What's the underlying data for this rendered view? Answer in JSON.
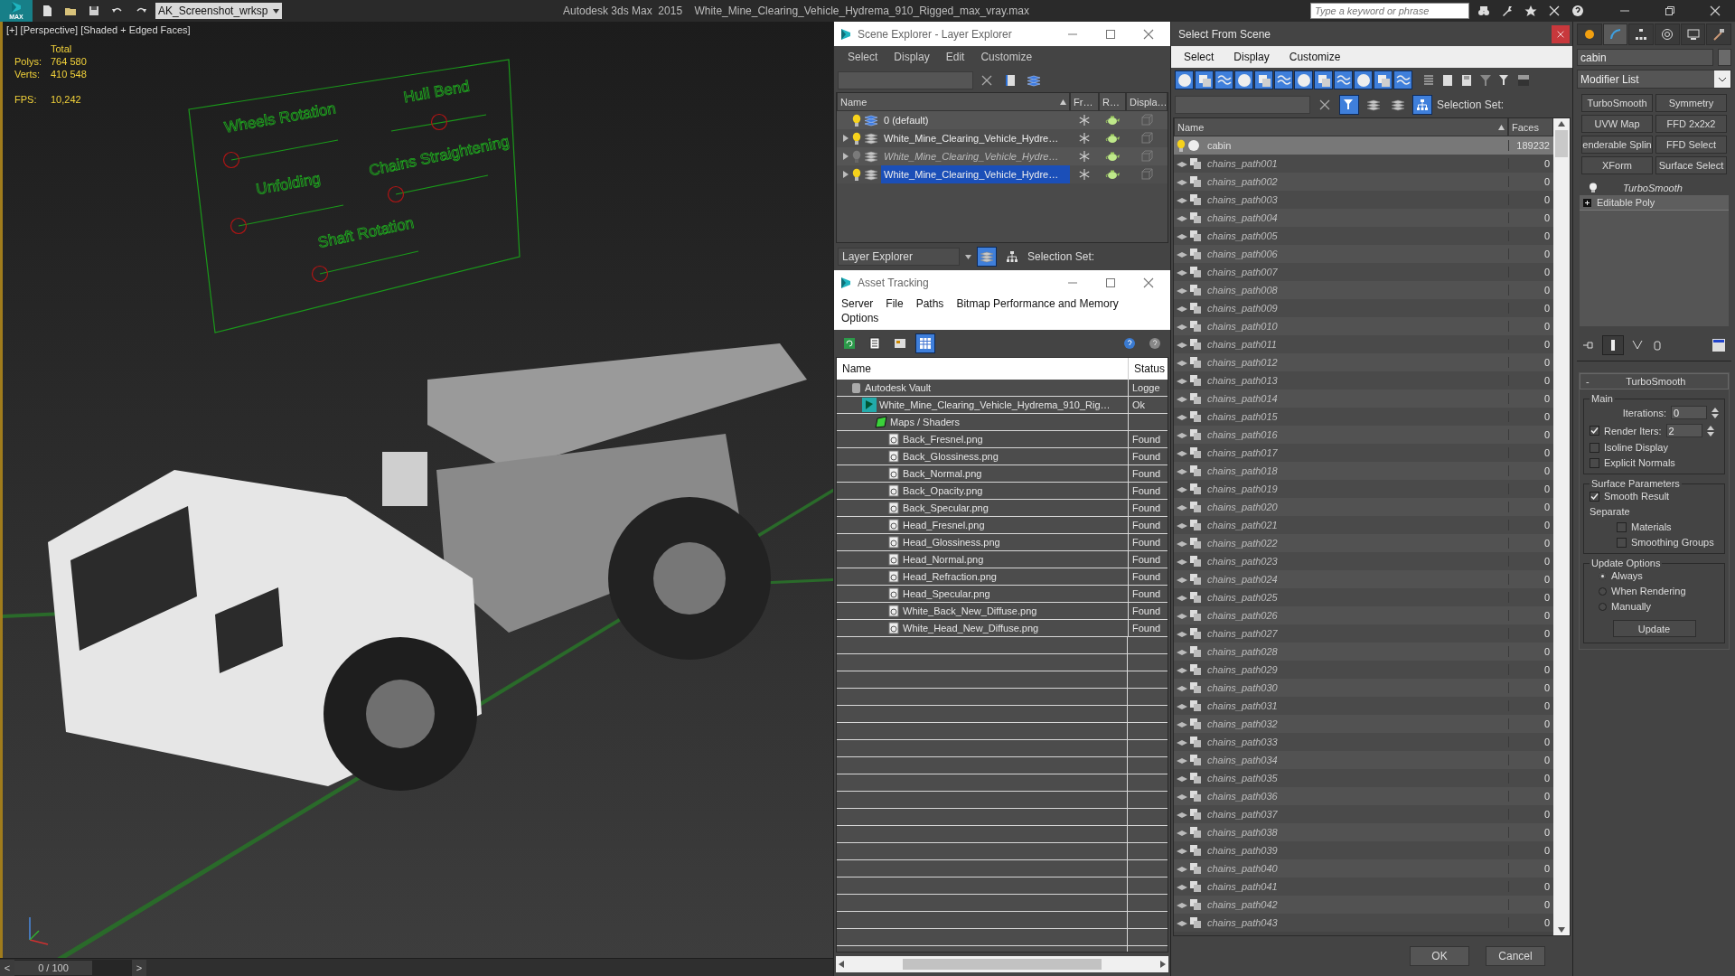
{
  "app": {
    "logo": "MAX",
    "workspace": "AK_Screenshot_wrksp",
    "title": "Autodesk 3ds Max  2015    White_Mine_Clearing_Vehicle_Hydrema_910_Rigged_max_vray.max",
    "search_placeholder": "Type a keyword or phrase"
  },
  "viewport": {
    "label": "[+] [Perspective] [Shaded + Edged Faces]",
    "stats_header": "Total",
    "stats": [
      {
        "label": "Polys:",
        "value": "764 580"
      },
      {
        "label": "Verts:",
        "value": "410 548"
      },
      {
        "label": "FPS:",
        "value": "10,242"
      }
    ],
    "rig_labels": [
      "Wheels Rotation",
      "Hull Bend",
      "Unfolding",
      "Chains Straightening",
      "Shaft Rotation"
    ],
    "timeline": {
      "prev": "<",
      "frame": "0 / 100",
      "next": ">"
    }
  },
  "scene_explorer": {
    "title": "Scene Explorer - Layer Explorer",
    "menu": [
      "Select",
      "Display",
      "Edit",
      "Customize"
    ],
    "columns": [
      "Name",
      "Fr…",
      "R…",
      "Displa…"
    ],
    "layers": [
      {
        "name": "0 (default)",
        "expandable": false,
        "hidden": false,
        "current": true,
        "selected": false
      },
      {
        "name": "White_Mine_Clearing_Vehicle_Hydre…",
        "expandable": true,
        "hidden": false,
        "current": false,
        "selected": false
      },
      {
        "name": "White_Mine_Clearing_Vehicle_Hydre…",
        "expandable": true,
        "hidden": true,
        "current": false,
        "selected": false
      },
      {
        "name": "White_Mine_Clearing_Vehicle_Hydre…",
        "expandable": true,
        "hidden": false,
        "current": false,
        "selected": true
      }
    ],
    "footer_mode": "Layer Explorer",
    "selection_set": "Selection Set:"
  },
  "asset_tracking": {
    "title": "Asset Tracking",
    "menu": [
      "Server",
      "File",
      "Paths",
      "Bitmap Performance and Memory",
      "Options"
    ],
    "view_modes": [
      {
        "selected": false
      },
      {
        "selected": false
      },
      {
        "selected": false
      },
      {
        "selected": true
      }
    ],
    "columns": [
      "Name",
      "Status"
    ],
    "items": [
      {
        "kind": "vault",
        "name": "Autodesk Vault",
        "status": "Logge",
        "children": [
          {
            "kind": "scene",
            "name": "White_Mine_Clearing_Vehicle_Hydrema_910_Rig…",
            "status": "Ok",
            "children": [
              {
                "kind": "folder",
                "name": "Maps / Shaders",
                "children": [
                  {
                    "kind": "bitmap",
                    "name": "Back_Fresnel.png",
                    "status": "Found"
                  },
                  {
                    "kind": "bitmap",
                    "name": "Back_Glossiness.png",
                    "status": "Found"
                  },
                  {
                    "kind": "bitmap",
                    "name": "Back_Normal.png",
                    "status": "Found"
                  },
                  {
                    "kind": "bitmap",
                    "name": "Back_Opacity.png",
                    "status": "Found"
                  },
                  {
                    "kind": "bitmap",
                    "name": "Back_Specular.png",
                    "status": "Found"
                  },
                  {
                    "kind": "bitmap",
                    "name": "Head_Fresnel.png",
                    "status": "Found"
                  },
                  {
                    "kind": "bitmap",
                    "name": "Head_Glossiness.png",
                    "status": "Found"
                  },
                  {
                    "kind": "bitmap",
                    "name": "Head_Normal.png",
                    "status": "Found"
                  },
                  {
                    "kind": "bitmap",
                    "name": "Head_Refraction.png",
                    "status": "Found"
                  },
                  {
                    "kind": "bitmap",
                    "name": "Head_Specular.png",
                    "status": "Found"
                  },
                  {
                    "kind": "bitmap",
                    "name": "White_Back_New_Diffuse.png",
                    "status": "Found"
                  },
                  {
                    "kind": "bitmap",
                    "name": "White_Head_New_Diffuse.png",
                    "status": "Found"
                  }
                ]
              }
            ]
          }
        ]
      }
    ]
  },
  "select_from_scene": {
    "title": "Select From Scene",
    "menu": [
      "Select",
      "Display",
      "Customize"
    ],
    "filters": [
      {
        "on": true
      },
      {
        "on": true
      },
      {
        "on": true
      },
      {
        "on": true
      },
      {
        "on": true
      },
      {
        "on": true
      },
      {
        "on": true
      },
      {
        "on": true
      },
      {
        "on": true
      },
      {
        "on": true
      },
      {
        "on": true
      },
      {
        "on": true
      }
    ],
    "selection_set": "Selection Set:",
    "columns": [
      "Name",
      "Faces"
    ],
    "objects": [
      {
        "kind": "mesh",
        "name": "cabin",
        "faces": "189232",
        "selected": true
      },
      {
        "kind": "shape",
        "name": "chains_path001",
        "faces": "0",
        "selected": false
      },
      {
        "kind": "shape",
        "name": "chains_path002",
        "faces": "0",
        "selected": false
      },
      {
        "kind": "shape",
        "name": "chains_path003",
        "faces": "0",
        "selected": false
      },
      {
        "kind": "shape",
        "name": "chains_path004",
        "faces": "0",
        "selected": false
      },
      {
        "kind": "shape",
        "name": "chains_path005",
        "faces": "0",
        "selected": false
      },
      {
        "kind": "shape",
        "name": "chains_path006",
        "faces": "0",
        "selected": false
      },
      {
        "kind": "shape",
        "name": "chains_path007",
        "faces": "0",
        "selected": false
      },
      {
        "kind": "shape",
        "name": "chains_path008",
        "faces": "0",
        "selected": false
      },
      {
        "kind": "shape",
        "name": "chains_path009",
        "faces": "0",
        "selected": false
      },
      {
        "kind": "shape",
        "name": "chains_path010",
        "faces": "0",
        "selected": false
      },
      {
        "kind": "shape",
        "name": "chains_path011",
        "faces": "0",
        "selected": false
      },
      {
        "kind": "shape",
        "name": "chains_path012",
        "faces": "0",
        "selected": false
      },
      {
        "kind": "shape",
        "name": "chains_path013",
        "faces": "0",
        "selected": false
      },
      {
        "kind": "shape",
        "name": "chains_path014",
        "faces": "0",
        "selected": false
      },
      {
        "kind": "shape",
        "name": "chains_path015",
        "faces": "0",
        "selected": false
      },
      {
        "kind": "shape",
        "name": "chains_path016",
        "faces": "0",
        "selected": false
      },
      {
        "kind": "shape",
        "name": "chains_path017",
        "faces": "0",
        "selected": false
      },
      {
        "kind": "shape",
        "name": "chains_path018",
        "faces": "0",
        "selected": false
      },
      {
        "kind": "shape",
        "name": "chains_path019",
        "faces": "0",
        "selected": false
      },
      {
        "kind": "shape",
        "name": "chains_path020",
        "faces": "0",
        "selected": false
      },
      {
        "kind": "shape",
        "name": "chains_path021",
        "faces": "0",
        "selected": false
      },
      {
        "kind": "shape",
        "name": "chains_path022",
        "faces": "0",
        "selected": false
      },
      {
        "kind": "shape",
        "name": "chains_path023",
        "faces": "0",
        "selected": false
      },
      {
        "kind": "shape",
        "name": "chains_path024",
        "faces": "0",
        "selected": false
      },
      {
        "kind": "shape",
        "name": "chains_path025",
        "faces": "0",
        "selected": false
      },
      {
        "kind": "shape",
        "name": "chains_path026",
        "faces": "0",
        "selected": false
      },
      {
        "kind": "shape",
        "name": "chains_path027",
        "faces": "0",
        "selected": false
      },
      {
        "kind": "shape",
        "name": "chains_path028",
        "faces": "0",
        "selected": false
      },
      {
        "kind": "shape",
        "name": "chains_path029",
        "faces": "0",
        "selected": false
      },
      {
        "kind": "shape",
        "name": "chains_path030",
        "faces": "0",
        "selected": false
      },
      {
        "kind": "shape",
        "name": "chains_path031",
        "faces": "0",
        "selected": false
      },
      {
        "kind": "shape",
        "name": "chains_path032",
        "faces": "0",
        "selected": false
      },
      {
        "kind": "shape",
        "name": "chains_path033",
        "faces": "0",
        "selected": false
      },
      {
        "kind": "shape",
        "name": "chains_path034",
        "faces": "0",
        "selected": false
      },
      {
        "kind": "shape",
        "name": "chains_path035",
        "faces": "0",
        "selected": false
      },
      {
        "kind": "shape",
        "name": "chains_path036",
        "faces": "0",
        "selected": false
      },
      {
        "kind": "shape",
        "name": "chains_path037",
        "faces": "0",
        "selected": false
      },
      {
        "kind": "shape",
        "name": "chains_path038",
        "faces": "0",
        "selected": false
      },
      {
        "kind": "shape",
        "name": "chains_path039",
        "faces": "0",
        "selected": false
      },
      {
        "kind": "shape",
        "name": "chains_path040",
        "faces": "0",
        "selected": false
      },
      {
        "kind": "shape",
        "name": "chains_path041",
        "faces": "0",
        "selected": false
      },
      {
        "kind": "shape",
        "name": "chains_path042",
        "faces": "0",
        "selected": false
      },
      {
        "kind": "shape",
        "name": "chains_path043",
        "faces": "0",
        "selected": false
      }
    ],
    "buttons": [
      "OK",
      "Cancel"
    ]
  },
  "command_panel": {
    "tabs": [
      {
        "selected": false
      },
      {
        "selected": true
      },
      {
        "selected": false
      },
      {
        "selected": false
      },
      {
        "selected": false
      },
      {
        "selected": false
      }
    ],
    "object_name": "cabin",
    "modifier_list": "Modifier List",
    "modifier_buttons": [
      "TurboSmooth",
      "Symmetry",
      "UVW Map",
      "FFD 2x2x2",
      "enderable Splin",
      "FFD Select",
      "XForm",
      "Surface Select"
    ],
    "stack": [
      {
        "kind": "modifier",
        "name": "TurboSmooth"
      },
      {
        "kind": "base",
        "name": "Editable Poly"
      }
    ],
    "rollout": {
      "collapse": "-",
      "title": "TurboSmooth",
      "main": {
        "title": "Main",
        "iterations_label": "Iterations:",
        "iterations": "0",
        "render_iters_label": "Render Iters:",
        "render_iters_checked": true,
        "render_iters": "2",
        "options": [
          {
            "label": "Isoline Display",
            "checked": false
          },
          {
            "label": "Explicit Normals",
            "checked": false
          }
        ]
      },
      "surface": {
        "title": "Surface Parameters",
        "smooth_label": "Smooth Result",
        "smooth_checked": true,
        "separate": "Separate",
        "options": [
          {
            "label": "Materials",
            "checked": false
          },
          {
            "label": "Smoothing Groups",
            "checked": false
          }
        ]
      },
      "update": {
        "title": "Update Options",
        "options": [
          {
            "label": "Always",
            "selected": true
          },
          {
            "label": "When Rendering",
            "selected": false
          },
          {
            "label": "Manually",
            "selected": false
          }
        ],
        "button": "Update"
      }
    }
  }
}
